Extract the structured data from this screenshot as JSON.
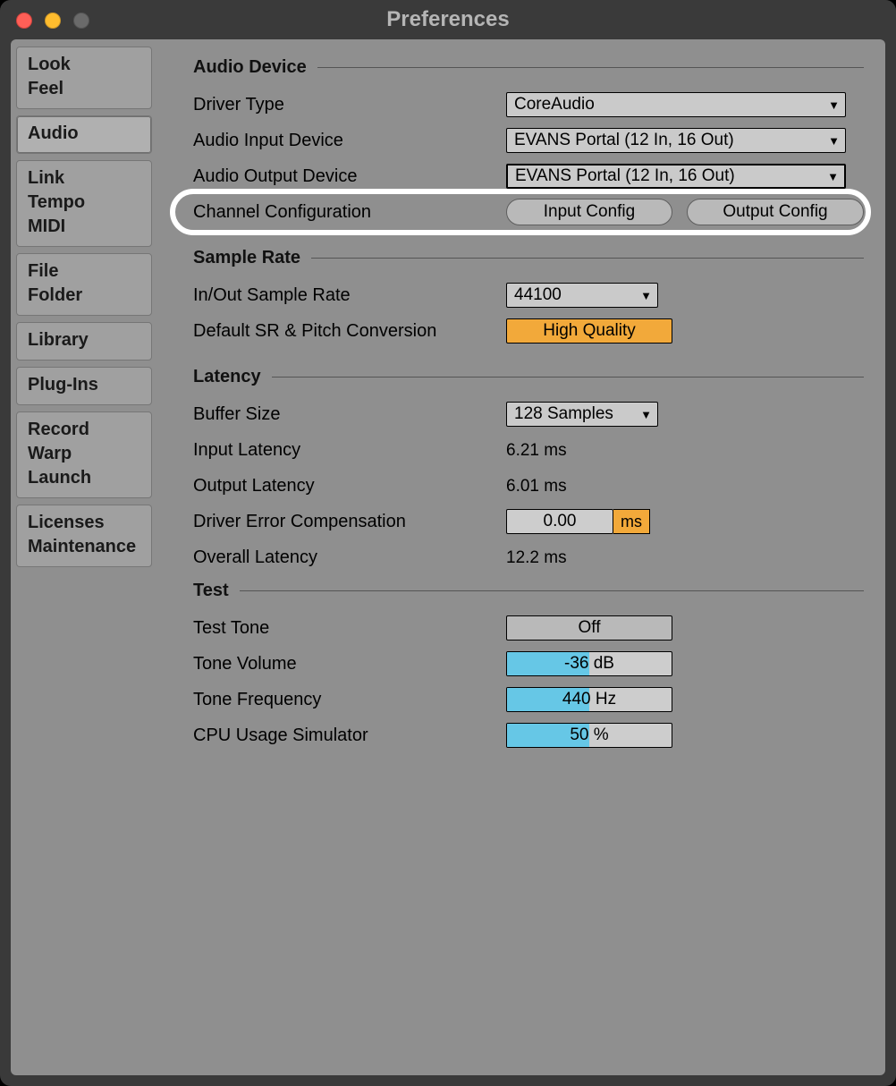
{
  "window": {
    "title": "Preferences"
  },
  "sidebar": {
    "groups": [
      {
        "lines": [
          "Look",
          "Feel"
        ]
      },
      {
        "lines": [
          "Audio"
        ],
        "active": true
      },
      {
        "lines": [
          "Link",
          "Tempo",
          "MIDI"
        ]
      },
      {
        "lines": [
          "File",
          "Folder"
        ]
      },
      {
        "lines": [
          "Library"
        ]
      },
      {
        "lines": [
          "Plug-Ins"
        ]
      },
      {
        "lines": [
          "Record",
          "Warp",
          "Launch"
        ]
      },
      {
        "lines": [
          "Licenses",
          "Maintenance"
        ]
      }
    ]
  },
  "sections": {
    "audio_device": {
      "title": "Audio Device",
      "driver_type": {
        "label": "Driver Type",
        "value": "CoreAudio"
      },
      "audio_input": {
        "label": "Audio Input Device",
        "value": "EVANS Portal (12 In, 16 Out)"
      },
      "audio_output": {
        "label": "Audio Output Device",
        "value": "EVANS Portal (12 In, 16 Out)"
      },
      "channel_config": {
        "label": "Channel Configuration",
        "input_btn": "Input Config",
        "output_btn": "Output Config"
      }
    },
    "sample_rate": {
      "title": "Sample Rate",
      "in_out": {
        "label": "In/Out Sample Rate",
        "value": "44100"
      },
      "default_sr": {
        "label": "Default SR & Pitch Conversion",
        "value": "High Quality"
      }
    },
    "latency": {
      "title": "Latency",
      "buffer_size": {
        "label": "Buffer Size",
        "value": "128 Samples"
      },
      "input_latency": {
        "label": "Input Latency",
        "value": "6.21 ms"
      },
      "output_latency": {
        "label": "Output Latency",
        "value": "6.01 ms"
      },
      "driver_error": {
        "label": "Driver Error Compensation",
        "value": "0.00",
        "unit": "ms"
      },
      "overall": {
        "label": "Overall Latency",
        "value": "12.2 ms"
      }
    },
    "test": {
      "title": "Test",
      "test_tone": {
        "label": "Test Tone",
        "value": "Off"
      },
      "tone_volume": {
        "label": "Tone Volume",
        "value": "-36 dB",
        "fill_pct": 50
      },
      "tone_freq": {
        "label": "Tone Frequency",
        "value": "440 Hz",
        "fill_pct": 50
      },
      "cpu_sim": {
        "label": "CPU Usage Simulator",
        "value": "50 %",
        "fill_pct": 50
      }
    }
  }
}
